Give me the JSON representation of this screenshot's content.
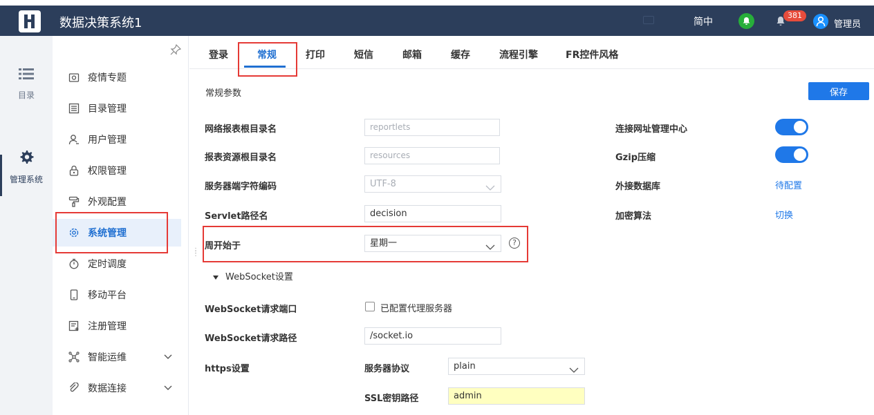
{
  "header": {
    "title": "数据决策系统1",
    "lang": "简中",
    "notification_count": "381",
    "user": "管理员"
  },
  "rail": {
    "directory": "目录",
    "system": "管理系统"
  },
  "sidebar": {
    "items": [
      {
        "label": "疫情专题"
      },
      {
        "label": "目录管理"
      },
      {
        "label": "用户管理"
      },
      {
        "label": "权限管理"
      },
      {
        "label": "外观配置"
      },
      {
        "label": "系统管理"
      },
      {
        "label": "定时调度"
      },
      {
        "label": "移动平台"
      },
      {
        "label": "注册管理"
      },
      {
        "label": "智能运维"
      },
      {
        "label": "数据连接"
      }
    ]
  },
  "tabs": [
    "登录",
    "常规",
    "打印",
    "短信",
    "邮箱",
    "缓存",
    "流程引擎",
    "FR控件风格"
  ],
  "general": {
    "section_title": "常规参数",
    "save_label": "保存",
    "report_root_label": "网络报表根目录名",
    "report_root_value": "reportlets",
    "resource_root_label": "报表资源根目录名",
    "resource_root_value": "resources",
    "charset_label": "服务器端字符编码",
    "charset_value": "UTF-8",
    "servlet_label": "Servlet路径名",
    "servlet_value": "decision",
    "week_start_label": "周开始于",
    "week_start_value": "星期一",
    "help_glyph": "?",
    "url_center_label": "连接网址管理中心",
    "gzip_label": "Gzip压缩",
    "external_db_label": "外接数据库",
    "external_db_link": "待配置",
    "encryption_label": "加密算法",
    "encryption_link": "切换"
  },
  "websocket": {
    "section_label": "WebSocket设置",
    "port_label": "WebSocket请求端口",
    "proxy_checkbox_label": "已配置代理服务器",
    "path_label": "WebSocket请求路径",
    "path_value": "/socket.io"
  },
  "https": {
    "label": "https设置",
    "protocol_label": "服务器协议",
    "protocol_value": "plain",
    "ssl_path_label": "SSL密钥路径",
    "ssl_path_value": "admin"
  },
  "colors": {
    "header_bg": "#2c3e5b",
    "accent": "#1f78e8",
    "highlight_box": "#e53935"
  }
}
